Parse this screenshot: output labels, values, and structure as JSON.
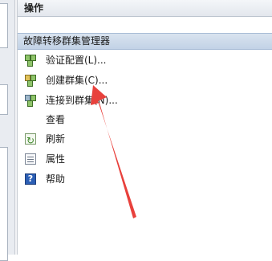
{
  "actions_panel": {
    "header": "操作",
    "section_title": "故障转移群集管理器",
    "items": [
      {
        "label": "验证配置(L)...",
        "icon": "validate-config-icon"
      },
      {
        "label": "创建群集(C)...",
        "icon": "create-cluster-icon"
      },
      {
        "label": "连接到群集(N)...",
        "icon": "connect-cluster-icon"
      },
      {
        "label": "查看",
        "icon": ""
      },
      {
        "label": "刷新",
        "icon": "refresh-icon"
      },
      {
        "label": "属性",
        "icon": "properties-icon"
      },
      {
        "label": "帮助",
        "icon": "help-icon"
      }
    ]
  },
  "annotation": {
    "color": "#e8413c"
  }
}
